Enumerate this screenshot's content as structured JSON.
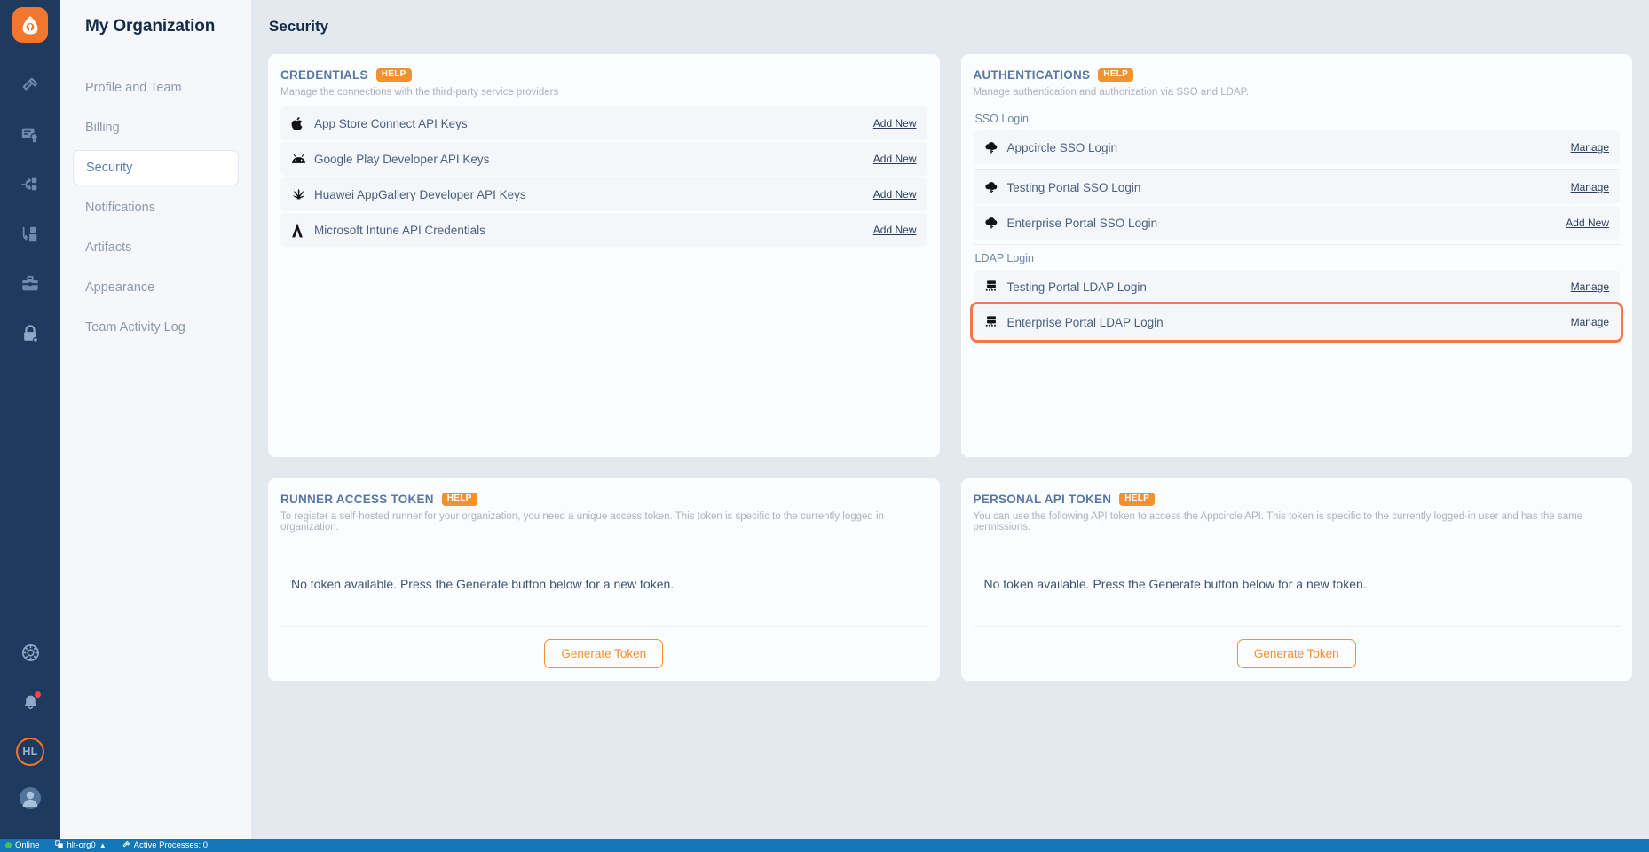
{
  "brand": {
    "logo_name": "appcircle-logo",
    "accent": "#f3902f",
    "rail_bg": "#1e3a5f",
    "highlight": "#f2764f"
  },
  "rail": {
    "items": [
      {
        "icon": "hammer-build-icon",
        "label": "Build"
      },
      {
        "icon": "certificate-signing-icon",
        "label": "Signing Identities"
      },
      {
        "icon": "distribution-icon",
        "label": "Distribution"
      },
      {
        "icon": "enterprise-store-icon",
        "label": "Enterprise App Store"
      },
      {
        "icon": "testing-distribution-icon",
        "label": "Testing Distribution"
      },
      {
        "icon": "lock-security-icon",
        "label": "My Organization"
      }
    ],
    "bottom": [
      {
        "icon": "settings-gear-icon",
        "label": "Settings"
      },
      {
        "icon": "notification-bell-icon",
        "label": "Notifications",
        "has_badge": true
      },
      {
        "icon": "org-avatar",
        "label": "HL"
      },
      {
        "icon": "user-profile-icon",
        "label": "Profile"
      }
    ]
  },
  "sidebar": {
    "title": "My Organization",
    "items": [
      {
        "label": "Profile and Team",
        "active": false
      },
      {
        "label": "Billing",
        "active": false
      },
      {
        "label": "Security",
        "active": true
      },
      {
        "label": "Notifications",
        "active": false
      },
      {
        "label": "Artifacts",
        "active": false
      },
      {
        "label": "Appearance",
        "active": false
      },
      {
        "label": "Team Activity Log",
        "active": false
      }
    ]
  },
  "header": {
    "title": "Security"
  },
  "credentials": {
    "title": "CREDENTIALS",
    "help_label": "HELP",
    "subtitle": "Manage the connections with the third-party service providers",
    "rows": [
      {
        "icon": "apple-icon",
        "label": "App Store Connect API Keys",
        "action": "Add New"
      },
      {
        "icon": "android-icon",
        "label": "Google Play Developer API Keys",
        "action": "Add New"
      },
      {
        "icon": "huawei-icon",
        "label": "Huawei AppGallery Developer API Keys",
        "action": "Add New"
      },
      {
        "icon": "microsoft-intune-icon",
        "label": "Microsoft Intune API Credentials",
        "action": "Add New"
      }
    ]
  },
  "authentications": {
    "title": "AUTHENTICATIONS",
    "help_label": "HELP",
    "subtitle": "Manage authentication and authorization via SSO and LDAP.",
    "sso_group_label": "SSO Login",
    "ldap_group_label": "LDAP Login",
    "sso_rows": [
      {
        "icon": "sso-key-icon",
        "label": "Appcircle SSO Login",
        "action": "Manage",
        "highlighted": false
      },
      {
        "icon": "sso-key-icon",
        "label": "Testing Portal SSO Login",
        "action": "Manage",
        "highlighted": false
      },
      {
        "icon": "sso-key-icon",
        "label": "Enterprise Portal SSO Login",
        "action": "Add New",
        "highlighted": false
      }
    ],
    "ldap_rows": [
      {
        "icon": "ldap-server-icon",
        "label": "Testing Portal LDAP Login",
        "action": "Manage",
        "highlighted": false
      },
      {
        "icon": "ldap-server-icon",
        "label": "Enterprise Portal LDAP Login",
        "action": "Manage",
        "highlighted": true
      }
    ]
  },
  "runner_token": {
    "title": "RUNNER ACCESS TOKEN",
    "help_label": "HELP",
    "subtitle": "To register a self-hosted runner for your organization, you need a unique access token. This token is specific to the currently logged in organization.",
    "message": "No token available. Press the Generate button below for a new token.",
    "button_label": "Generate Token"
  },
  "personal_token": {
    "title": "PERSONAL API TOKEN",
    "help_label": "HELP",
    "subtitle": "You can use the following API token to access the Appcircle API. This token is specific to the currently logged-in user and has the same permissions.",
    "message": "No token available. Press the Generate button below for a new token.",
    "button_label": "Generate Token"
  },
  "statusbar": {
    "online_label": "Online",
    "org_label": "hlt-org0",
    "processes_label": "Active Processes: 0"
  }
}
